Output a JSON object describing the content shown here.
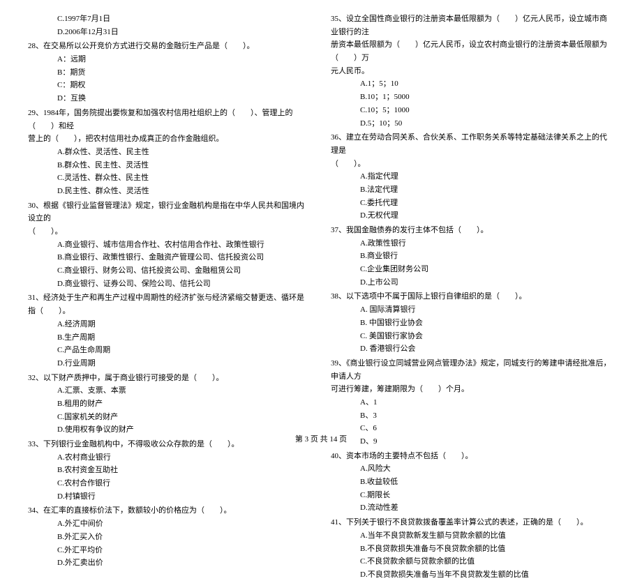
{
  "left": {
    "q27": {
      "c": "C.1997年7月1日",
      "d": "D.2006年12月31日"
    },
    "q28": {
      "stem": "28、在交易所以公开竞价方式进行交易的金融衍生产品是（　　）。",
      "a": "A：远期",
      "b": "B：期货",
      "c": "C：期权",
      "d": "D：互换"
    },
    "q29": {
      "stem1": "29、1984年，国务院提出要恢复和加强农村信用社组织上的（　　）、管理上的（　　）和经",
      "stem2": "营上的（　　），把农村信用社办成真正的合作金融组织。",
      "a": "A.群众性、灵活性、民主性",
      "b": "B.群众性、民主性、灵活性",
      "c": "C.灵活性、群众性、民主性",
      "d": "D.民主性、群众性、灵活性"
    },
    "q30": {
      "stem1": "30、根据《银行业监督管理法》规定，银行业金融机构是指在中华人民共和国境内设立的",
      "stem2": "（　　）。",
      "a": "A.商业银行、城市信用合作社、农村信用合作社、政策性银行",
      "b": "B.商业银行、政策性银行、金融资产管理公司、信托投资公司",
      "c": "C.商业银行、财务公司、信托投资公司、金融租赁公司",
      "d": "D.商业银行、证券公司、保险公司、信托公司"
    },
    "q31": {
      "stem": "31、经济处于生产和再生产过程中周期性的经济扩张与经济紧缩交替更迭、循环是指（　　）。",
      "a": "A.经济周期",
      "b": "B.生产周期",
      "c": "C.产品生命周期",
      "d": "D.行业周期"
    },
    "q32": {
      "stem": "32、以下财产质押中，属于商业银行可接受的是（　　）。",
      "a": "A.汇票、支票、本票",
      "b": "B.租用的财产",
      "c": "C.国家机关的财产",
      "d": "D.使用权有争议的财产"
    },
    "q33": {
      "stem": "33、下列银行业金融机构中，不得吸收公众存款的是（　　）。",
      "a": "A.农村商业银行",
      "b": "B.农村资金互助社",
      "c": "C.农村合作银行",
      "d": "D.村镇银行"
    },
    "q34": {
      "stem": "34、在汇率的直接标价法下，数额较小的价格应为（　　）。",
      "a": "A.外汇中间价",
      "b": "B.外汇买入价",
      "c": "C.外汇平均价",
      "d": "D.外汇卖出价"
    }
  },
  "right": {
    "q35": {
      "stem1": "35、设立全国性商业银行的注册资本最低限额为（　　）亿元人民币，设立城市商业银行的注",
      "stem2": "册资本最低限额为（　　）亿元人民币，设立农村商业银行的注册资本最低限额为（　　）万",
      "stem3": "元人民币。",
      "a": "A.1；5；10",
      "b": "B.10；1；5000",
      "c": "C.10；5；1000",
      "d": "D.5；10；50"
    },
    "q36": {
      "stem1": "36、建立在劳动合同关系、合伙关系、工作职务关系等特定基础法律关系之上的代理是",
      "stem2": "（　　）。",
      "a": "A.指定代理",
      "b": "B.法定代理",
      "c": "C.委托代理",
      "d": "D.无权代理"
    },
    "q37": {
      "stem": "37、我国金融债券的发行主体不包括（　　）。",
      "a": "A.政策性银行",
      "b": "B.商业银行",
      "c": "C.企业集团财务公司",
      "d": "D.上市公司"
    },
    "q38": {
      "stem": "38、以下选项中不属于国际上银行自律组织的是（　　）。",
      "a": "A. 国际清算银行",
      "b": "B. 中国银行业协会",
      "c": "C. 美国银行家协会",
      "d": "D. 香港银行公会"
    },
    "q39": {
      "stem1": "39、《商业银行设立同城营业网点管理办法》规定，同城支行的筹建申请经批准后，申请人方",
      "stem2": "可进行筹建，筹建期限为（　　）个月。",
      "a": "A、1",
      "b": "B、3",
      "c": "C、6",
      "d": "D、9"
    },
    "q40": {
      "stem": "40、资本市场的主要特点不包括（　　）。",
      "a": "A.风险大",
      "b": "B.收益较低",
      "c": "C.期限长",
      "d": "D.流动性差"
    },
    "q41": {
      "stem": "41、下列关于银行不良贷款拨备覆盖率计算公式的表述，正确的是（　　）。",
      "a": "A.当年不良贷款新发生额与贷款余额的比值",
      "b": "B.不良贷款损失准备与不良贷款余额的比值",
      "c": "C.不良贷款余额与贷款余额的比值",
      "d": "D.不良贷款损失准备与当年不良贷款发生额的比值"
    }
  },
  "footer": "第 3 页 共 14 页"
}
